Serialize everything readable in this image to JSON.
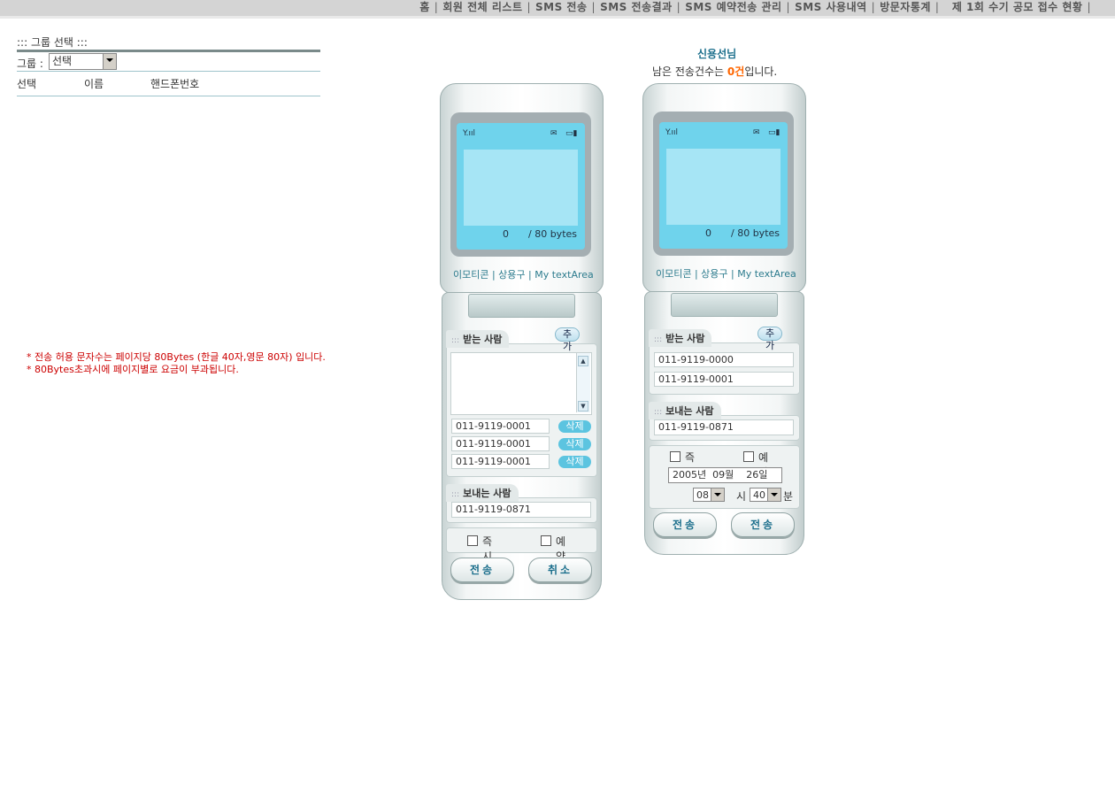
{
  "nav": {
    "items": [
      "홈",
      "회원 전체 리스트",
      "SMS 전송",
      "SMS 전송결과",
      "SMS 예약전송 관리",
      "SMS 사용내역",
      "방문자통계",
      "제 1회 수기 공모 접수 현황"
    ],
    "separator": "|"
  },
  "left": {
    "title": "::: 그룹 선택 :::",
    "group_label": "그룹 :",
    "group_select": "선택",
    "columns": [
      "선택",
      "이름",
      "핸드폰번호"
    ],
    "notices": [
      "* 전송 허용 문자수는 페이지당 80Bytes (한글 40자,영문 80자) 입니다.",
      "* 80Bytes초과시에 페이지별로 요금이 부과됩니다."
    ]
  },
  "user": {
    "name": "신용선님",
    "remain_prefix": "남은 전송건수는 ",
    "remain_count": "0건",
    "remain_suffix": "입니다."
  },
  "phone1": {
    "byte_count": "0",
    "byte_limit": "/ 80 bytes",
    "soft_links": "이모티콘 | 상용구 | My textArea",
    "recv_tab": "받는 사람",
    "add_label": "추가",
    "recipients": [
      "011-9119-0001",
      "011-9119-0001",
      "011-9119-0001"
    ],
    "delete_label": "삭제",
    "sender_tab": "보내는 사람",
    "sender": "011-9119-0871",
    "immediate_label": "즉시",
    "reserve_label": "예약",
    "send_label": "전송",
    "cancel_label": "취소"
  },
  "phone2": {
    "byte_count": "0",
    "byte_limit": "/ 80 bytes",
    "soft_links": "이모티콘 | 상용구 | My textArea",
    "recv_tab": "받는 사람",
    "add_label": "추가",
    "recipients": [
      "011-9119-0000",
      "011-9119-0001"
    ],
    "sender_tab": "보내는 사람",
    "sender": "011-9119-0871",
    "immediate_label": "즉시",
    "reserve_label": "예약",
    "date": "2005년  09월    26일",
    "hour": "08",
    "hour_label": "시",
    "minute": "40",
    "minute_label": "분",
    "send_label_1": "전송",
    "send_label_2": "전송"
  },
  "colors": {
    "accent": "#1c6f8c",
    "count": "#ff6600",
    "notice": "#cc0000",
    "screen": "#6fd3ec"
  }
}
